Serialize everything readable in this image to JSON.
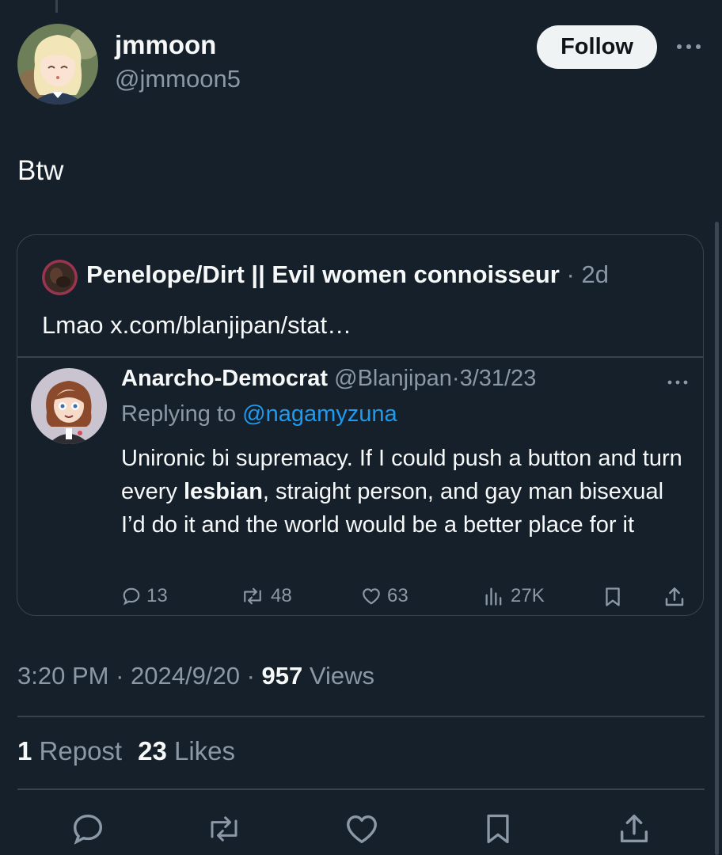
{
  "author": {
    "display_name": "jmmoon",
    "handle": "@jmmoon5",
    "follow_label": "Follow"
  },
  "tweet": {
    "text": "Btw"
  },
  "quote": {
    "author_name": "Penelope/Dirt || Evil women connoisseur",
    "separator": "·",
    "time": "2d",
    "text": "Lmao x.com/blanjipan/stat…",
    "screenshot": {
      "author_name": "Anarcho-Democrat",
      "handle": "@Blanjipan",
      "separator": "·",
      "date": "3/31/23",
      "replying_prefix": "Replying to",
      "replying_to": "@nagamyzuna",
      "body_before": "Unironic bi supremacy. If I could push a button and turn every ",
      "body_bold": "lesbian",
      "body_after": ", straight person, and gay man bisexual I’d do it and the world would be a better place for it",
      "replies": "13",
      "reposts": "48",
      "likes": "63",
      "views": "27K"
    }
  },
  "meta": {
    "time": "3:20 PM",
    "separator": "·",
    "date": "2024/9/20",
    "views_count": "957",
    "views_label": "Views"
  },
  "stats": {
    "reposts_count": "1",
    "reposts_label": "Repost",
    "likes_count": "23",
    "likes_label": "Likes"
  },
  "icons": {
    "action_color": "#8b98a5",
    "accent": "#1d9bf0",
    "names": [
      "reply-icon",
      "repost-icon",
      "like-icon",
      "bookmark-icon",
      "share-icon",
      "views-icon",
      "more-icon"
    ]
  }
}
